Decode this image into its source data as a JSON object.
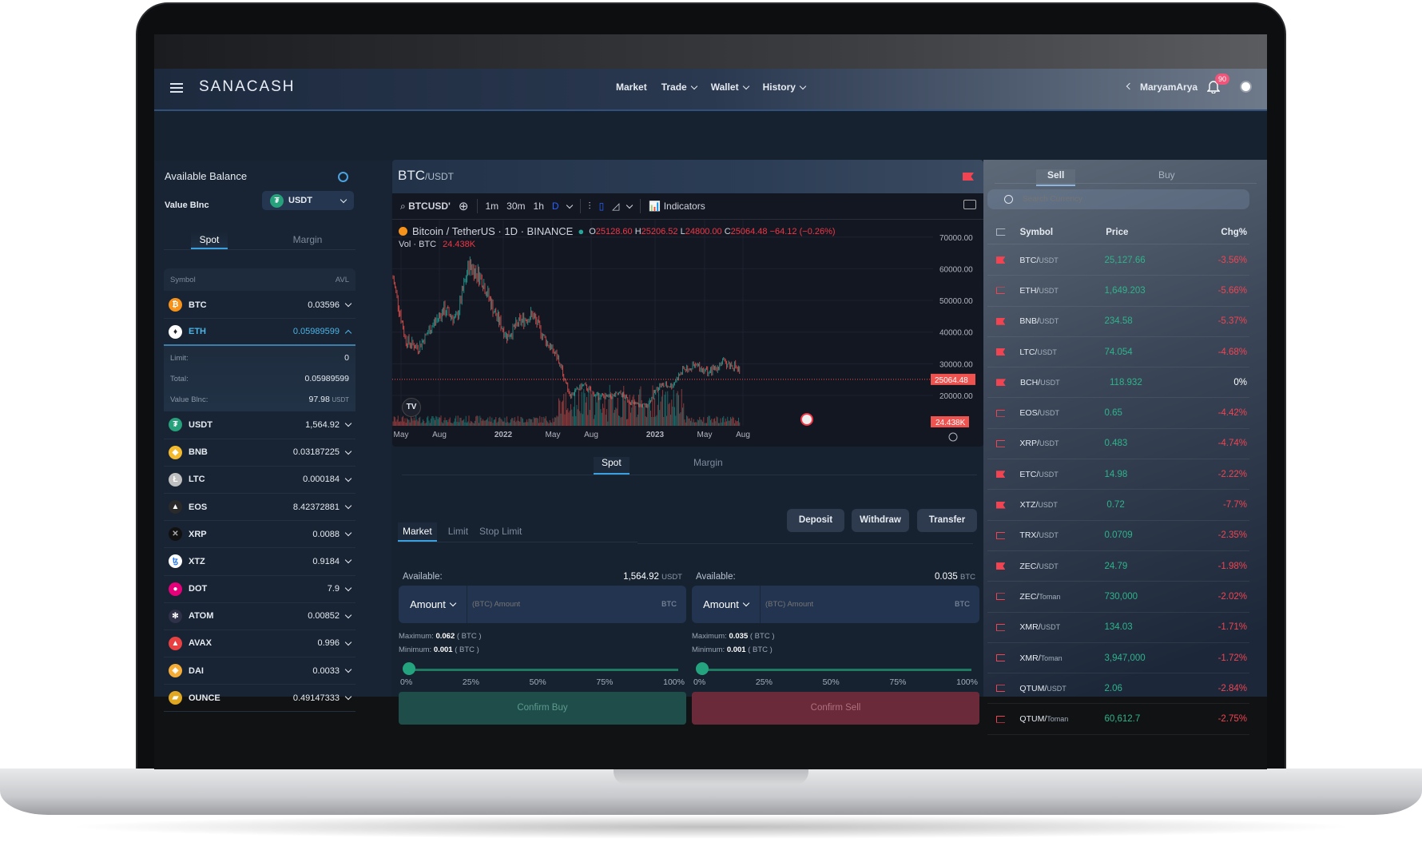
{
  "header": {
    "logo": "SANACASH",
    "nav": [
      {
        "label": "Market",
        "dropdown": false
      },
      {
        "label": "Trade",
        "dropdown": true
      },
      {
        "label": "Wallet",
        "dropdown": true
      },
      {
        "label": "History",
        "dropdown": true
      }
    ],
    "username": "MaryamArya",
    "notifications": "90"
  },
  "balance": {
    "title": "Available Balance",
    "value_label": "Value Blnc",
    "currency": "USDT",
    "tabs": [
      "Spot",
      "Margin"
    ],
    "col_symbol": "Symbol",
    "col_avl": "AVL",
    "coins": [
      {
        "symbol": "BTC",
        "amount": "0.03596",
        "color": "#f7931a",
        "glyph": "₿"
      },
      {
        "symbol": "ETH",
        "amount": "0.05989599",
        "color": "#ffffff",
        "glyph": "♦",
        "expanded": true,
        "limit_label": "Limit:",
        "limit": "0",
        "total_label": "Total:",
        "total": "0.05989599",
        "value_label": "Value Blnc:",
        "value": "97.98",
        "value_unit": "USDT"
      },
      {
        "symbol": "USDT",
        "amount": "1,564.92",
        "color": "#26a17b",
        "glyph": "₮"
      },
      {
        "symbol": "BNB",
        "amount": "0.03187225",
        "color": "#f3ba2f",
        "glyph": "◆"
      },
      {
        "symbol": "LTC",
        "amount": "0.000184",
        "color": "#bfbfbf",
        "glyph": "Ł"
      },
      {
        "symbol": "EOS",
        "amount": "8.42372881",
        "color": "#2a2a2a",
        "glyph": "▲"
      },
      {
        "symbol": "XRP",
        "amount": "0.0088",
        "color": "#111111",
        "glyph": "✕"
      },
      {
        "symbol": "XTZ",
        "amount": "0.9184",
        "color": "#ffffff",
        "glyph": "ꜩ"
      },
      {
        "symbol": "DOT",
        "amount": "7.9",
        "color": "#e6007a",
        "glyph": "●"
      },
      {
        "symbol": "ATOM",
        "amount": "0.00852",
        "color": "#2e3148",
        "glyph": "✻"
      },
      {
        "symbol": "AVAX",
        "amount": "0.996",
        "color": "#e84142",
        "glyph": "▲"
      },
      {
        "symbol": "DAI",
        "amount": "0.0033",
        "color": "#f5ac37",
        "glyph": "◈"
      },
      {
        "symbol": "OUNCE",
        "amount": "0.49147333",
        "color": "#e0a820",
        "glyph": "▰"
      }
    ]
  },
  "chart": {
    "base": "BTC",
    "quote": "/USDT",
    "toolbar": {
      "symbol": "BTCUSD'",
      "intervals": [
        "1m",
        "30m",
        "1h",
        "D"
      ],
      "indicators": "Indicators"
    },
    "legend": {
      "name": "Bitcoin / TetherUS · 1D · BINANCE",
      "o_label": "O",
      "o": "25128.60",
      "h_label": "H",
      "h": "25206.52",
      "l_label": "L",
      "l": "24800.00",
      "c_label": "C",
      "c": "25064.48",
      "change": "−64.12 (−0.26%)"
    },
    "vol_label": "Vol · BTC",
    "vol": "24.438K",
    "logo": "TV"
  },
  "chart_data": {
    "type": "candlestick",
    "yticks": [
      70000,
      60000,
      50000,
      40000,
      30000,
      20000
    ],
    "ylim": [
      10400,
      75500
    ],
    "xticks": [
      "May",
      "Aug",
      "2022",
      "May",
      "Aug",
      "2023",
      "May",
      "Aug"
    ],
    "last_price": "25064.48",
    "last_volume": "24.438K",
    "grid": true,
    "monthly_close_approx": {
      "x": [
        "2021-04",
        "2021-05",
        "2021-06",
        "2021-07",
        "2021-08",
        "2021-09",
        "2021-10",
        "2021-11",
        "2021-12",
        "2022-01",
        "2022-02",
        "2022-03",
        "2022-04",
        "2022-05",
        "2022-06",
        "2022-07",
        "2022-08",
        "2022-09",
        "2022-10",
        "2022-11",
        "2022-12",
        "2023-01",
        "2023-02",
        "2023-03",
        "2023-04",
        "2023-05",
        "2023-06",
        "2023-07",
        "2023-08"
      ],
      "y": [
        57000,
        37300,
        35000,
        41500,
        47100,
        43800,
        61300,
        57000,
        46300,
        38500,
        43200,
        45500,
        37700,
        31800,
        19900,
        23300,
        20000,
        19400,
        20500,
        17200,
        16500,
        23100,
        23100,
        28500,
        29200,
        27200,
        30500,
        29200,
        25064
      ]
    }
  },
  "trade": {
    "tabs": [
      "Spot",
      "Margin"
    ],
    "order_types": [
      "Market",
      "Limit",
      "Stop Limit"
    ],
    "actions": [
      "Deposit",
      "Withdraw",
      "Transfer"
    ],
    "buy": {
      "available_label": "Available:",
      "available": "1,564.92",
      "unit": "USDT",
      "amount_label": "Amount",
      "placeholder": "(BTC) Amount",
      "field_unit": "BTC",
      "max_label": "Maximum:",
      "max": "0.062",
      "min_label": "Minimum:",
      "min": "0.001",
      "paren_unit": "( BTC )",
      "percent": 0,
      "confirm": "Confirm Buy"
    },
    "sell": {
      "available_label": "Available:",
      "available": "0.035",
      "unit": "BTC",
      "amount_label": "Amount",
      "placeholder": "(BTC) Amount",
      "field_unit": "BTC",
      "max_label": "Maximum:",
      "max": "0.035",
      "min_label": "Minimum:",
      "min": "0.001",
      "paren_unit": "( BTC )",
      "percent": 0,
      "confirm": "Confirm Sell"
    },
    "pct_labels": [
      "0%",
      "25%",
      "50%",
      "75%",
      "100%"
    ]
  },
  "market": {
    "tabs": [
      "Sell",
      "Buy"
    ],
    "search_placeholder": "Search Currency",
    "cols": [
      "Symbol",
      "Price",
      "Chg%"
    ],
    "rows": [
      {
        "base": "BTC/",
        "quote": "USDT",
        "price": "25,127.66",
        "chg": "-3.56%",
        "fav": true
      },
      {
        "base": "ETH/",
        "quote": "USDT",
        "price": "1,649.203",
        "chg": "-5.66%",
        "fav": false
      },
      {
        "base": "BNB/",
        "quote": "USDT",
        "price": "234.58",
        "chg": "-5.37%",
        "fav": true
      },
      {
        "base": "LTC/",
        "quote": "USDT",
        "price": "74.054",
        "chg": "-4.68%",
        "fav": true
      },
      {
        "base": "BCH/",
        "quote": "USDT",
        "price": "118.932",
        "chg": "0%",
        "fav": true
      },
      {
        "base": "EOS/",
        "quote": "USDT",
        "price": "0.65",
        "chg": "-4.42%",
        "fav": false
      },
      {
        "base": "XRP/",
        "quote": "USDT",
        "price": "0.483",
        "chg": "-4.74%",
        "fav": false
      },
      {
        "base": "ETC/",
        "quote": "USDT",
        "price": "14.98",
        "chg": "-2.22%",
        "fav": true
      },
      {
        "base": "XTZ/",
        "quote": "USDT",
        "price": "0.72",
        "chg": "-7.7%",
        "fav": true
      },
      {
        "base": "TRX/",
        "quote": "USDT",
        "price": "0.0709",
        "chg": "-2.35%",
        "fav": false
      },
      {
        "base": "ZEC/",
        "quote": "USDT",
        "price": "24.79",
        "chg": "-1.98%",
        "fav": true
      },
      {
        "base": "ZEC/",
        "quote": "Toman",
        "price": "730,000",
        "chg": "-2.02%",
        "fav": false
      },
      {
        "base": "XMR/",
        "quote": "USDT",
        "price": "134.03",
        "chg": "-1.71%",
        "fav": false
      },
      {
        "base": "XMR/",
        "quote": "Toman",
        "price": "3,947,000",
        "chg": "-1.72%",
        "fav": false
      },
      {
        "base": "QTUM/",
        "quote": "USDT",
        "price": "2.06",
        "chg": "-2.84%",
        "fav": false
      },
      {
        "base": "QTUM/",
        "quote": "Toman",
        "price": "60,612.7",
        "chg": "-2.75%",
        "fav": false
      }
    ]
  },
  "colors": {
    "up": "#26a69a",
    "down": "#ef5350",
    "accent": "#3aa0e0",
    "buy": "#1e4d4a",
    "sell": "#6a2a3a"
  }
}
